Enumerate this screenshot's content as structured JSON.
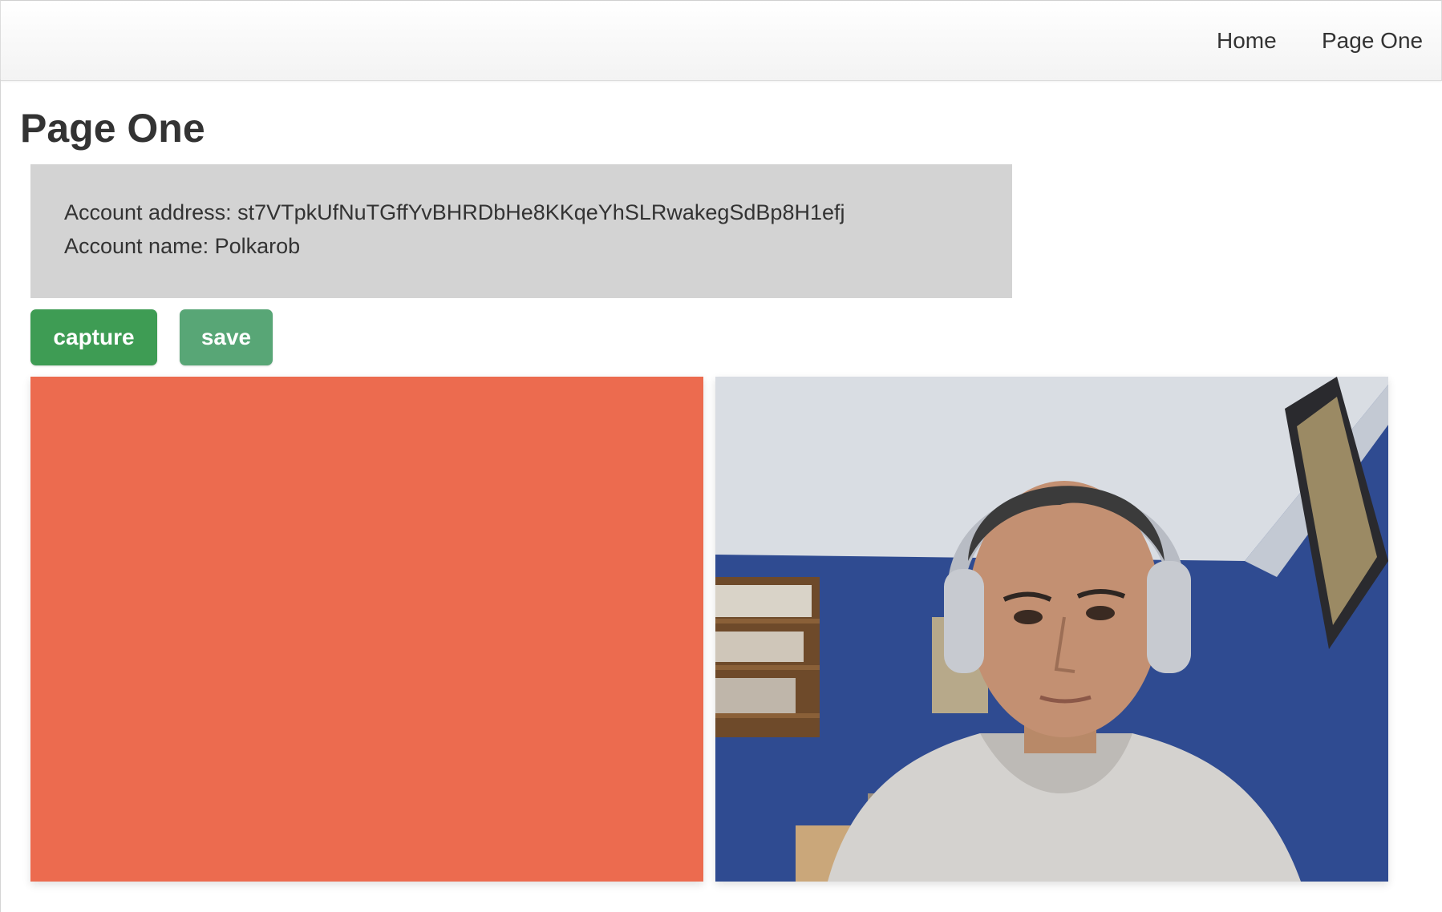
{
  "nav": {
    "home_label": "Home",
    "page_one_label": "Page One"
  },
  "page": {
    "title": "Page One"
  },
  "account": {
    "address_line": "Account address: st7VTpkUfNuTGffYvBHRDbHe8KKqeYhSLRwakegSdBp8H1efj",
    "name_line": "Account name: Polkarob"
  },
  "buttons": {
    "capture_label": "capture",
    "save_label": "save"
  },
  "colors": {
    "capture_button": "#3e9c54",
    "save_button": "#58a676",
    "canvas_fill": "#ec6b4f",
    "account_box": "#d3d3d3"
  }
}
